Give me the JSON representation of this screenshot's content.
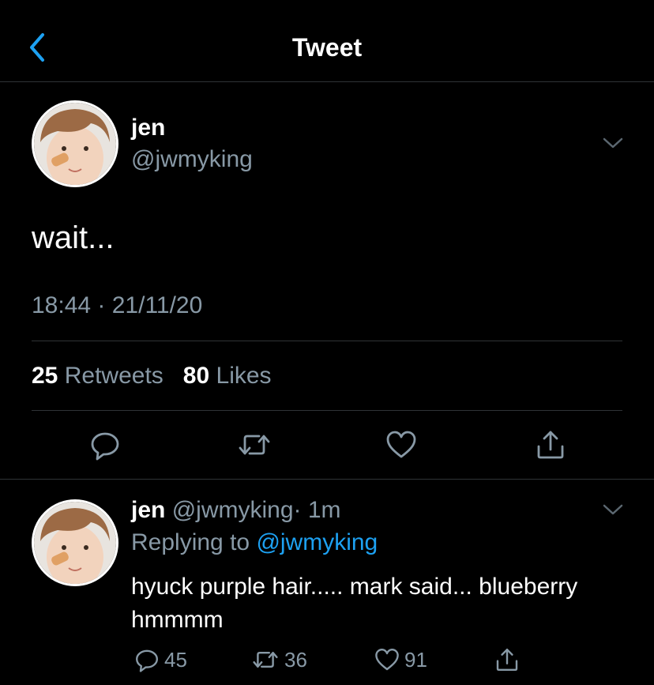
{
  "header": {
    "title": "Tweet",
    "back_icon": "chevron-left-icon",
    "accent": "#1da1f2"
  },
  "tweet": {
    "name": "jen",
    "handle": "@jwmyking",
    "text": "wait...",
    "timestamp": "18:44 · 21/11/20",
    "retweets_count": "25",
    "retweets_label": "Retweets",
    "likes_count": "80",
    "likes_label": "Likes",
    "actions": [
      "reply-icon",
      "retweet-icon",
      "like-icon",
      "share-icon"
    ]
  },
  "reply": {
    "name": "jen",
    "handle": "@jwmyking",
    "time": "· 1m",
    "replying_prefix": "Replying to",
    "replying_to": "@jwmyking",
    "text": "hyuck purple hair..... mark said... blueberry hmmmm",
    "reply_count": "45",
    "retweet_count": "36",
    "like_count": "91"
  },
  "colors": {
    "background": "#000000",
    "muted": "#8899a6",
    "link": "#1da1f2",
    "divider": "#2f3336"
  }
}
